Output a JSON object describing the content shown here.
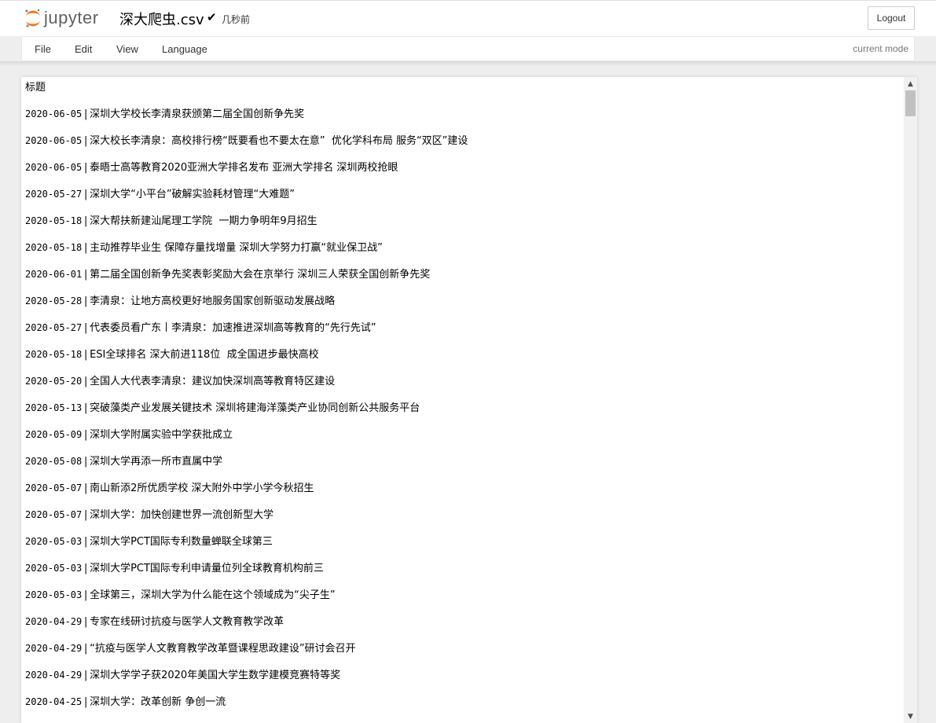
{
  "header": {
    "logo_text": "jupyter",
    "notebook_title": "深大爬虫.csv",
    "save_status": "几秒前",
    "logout_label": "Logout"
  },
  "menubar": {
    "items": [
      "File",
      "Edit",
      "View",
      "Language"
    ],
    "mode": "current mode"
  },
  "colors": {
    "jupyter_orange": "#f37726",
    "logo_gray": "#616161",
    "background": "#eeeeee"
  },
  "editor": {
    "header_line": "标题",
    "rows": [
      {
        "date": "2020-06-05",
        "title": "深圳大学校长李清泉获颁第二届全国创新争先奖"
      },
      {
        "date": "2020-06-05",
        "title": "深大校长李清泉：高校排行榜“既要看也不要太在意”  优化学科布局 服务“双区”建设"
      },
      {
        "date": "2020-06-05",
        "title": "泰晤士高等教育2020亚洲大学排名发布 亚洲大学排名 深圳两校抢眼"
      },
      {
        "date": "2020-05-27",
        "title": "深圳大学“小平台”破解实验耗材管理“大难题”"
      },
      {
        "date": "2020-05-18",
        "title": "深大帮扶新建汕尾理工学院  一期力争明年9月招生"
      },
      {
        "date": "2020-05-18",
        "title": "主动推荐毕业生 保障存量找增量 深圳大学努力打赢“就业保卫战”"
      },
      {
        "date": "2020-06-01",
        "title": "第二届全国创新争先奖表彰奖励大会在京举行 深圳三人荣获全国创新争先奖"
      },
      {
        "date": "2020-05-28",
        "title": "李清泉：让地方高校更好地服务国家创新驱动发展战略"
      },
      {
        "date": "2020-05-27",
        "title": "代表委员看广东丨李清泉：加速推进深圳高等教育的“先行先试”"
      },
      {
        "date": "2020-05-18",
        "title": "ESI全球排名 深大前进118位  成全国进步最快高校"
      },
      {
        "date": "2020-05-20",
        "title": "全国人大代表李清泉：建议加快深圳高等教育特区建设"
      },
      {
        "date": "2020-05-13",
        "title": "突破藻类产业发展关键技术 深圳将建海洋藻类产业协同创新公共服务平台"
      },
      {
        "date": "2020-05-09",
        "title": "深圳大学附属实验中学获批成立"
      },
      {
        "date": "2020-05-08",
        "title": "深圳大学再添一所市直属中学"
      },
      {
        "date": "2020-05-07",
        "title": "南山新添2所优质学校 深大附外中学小学今秋招生"
      },
      {
        "date": "2020-05-07",
        "title": "深圳大学：加快创建世界一流创新型大学"
      },
      {
        "date": "2020-05-03",
        "title": "深圳大学PCT国际专利数量蝉联全球第三"
      },
      {
        "date": "2020-05-03",
        "title": "深圳大学PCT国际专利申请量位列全球教育机构前三"
      },
      {
        "date": "2020-05-03",
        "title": "全球第三，深圳大学为什么能在这个领域成为“尖子生”"
      },
      {
        "date": "2020-04-29",
        "title": "专家在线研讨抗疫与医学人文教育教学改革"
      },
      {
        "date": "2020-04-29",
        "title": "“抗疫与医学人文教育教学改革暨课程思政建设”研讨会召开"
      },
      {
        "date": "2020-04-29",
        "title": "深圳大学学子获2020年美国大学生数学建模竞赛特等奖"
      },
      {
        "date": "2020-04-25",
        "title": "深圳大学：改革创新 争创一流"
      }
    ]
  }
}
